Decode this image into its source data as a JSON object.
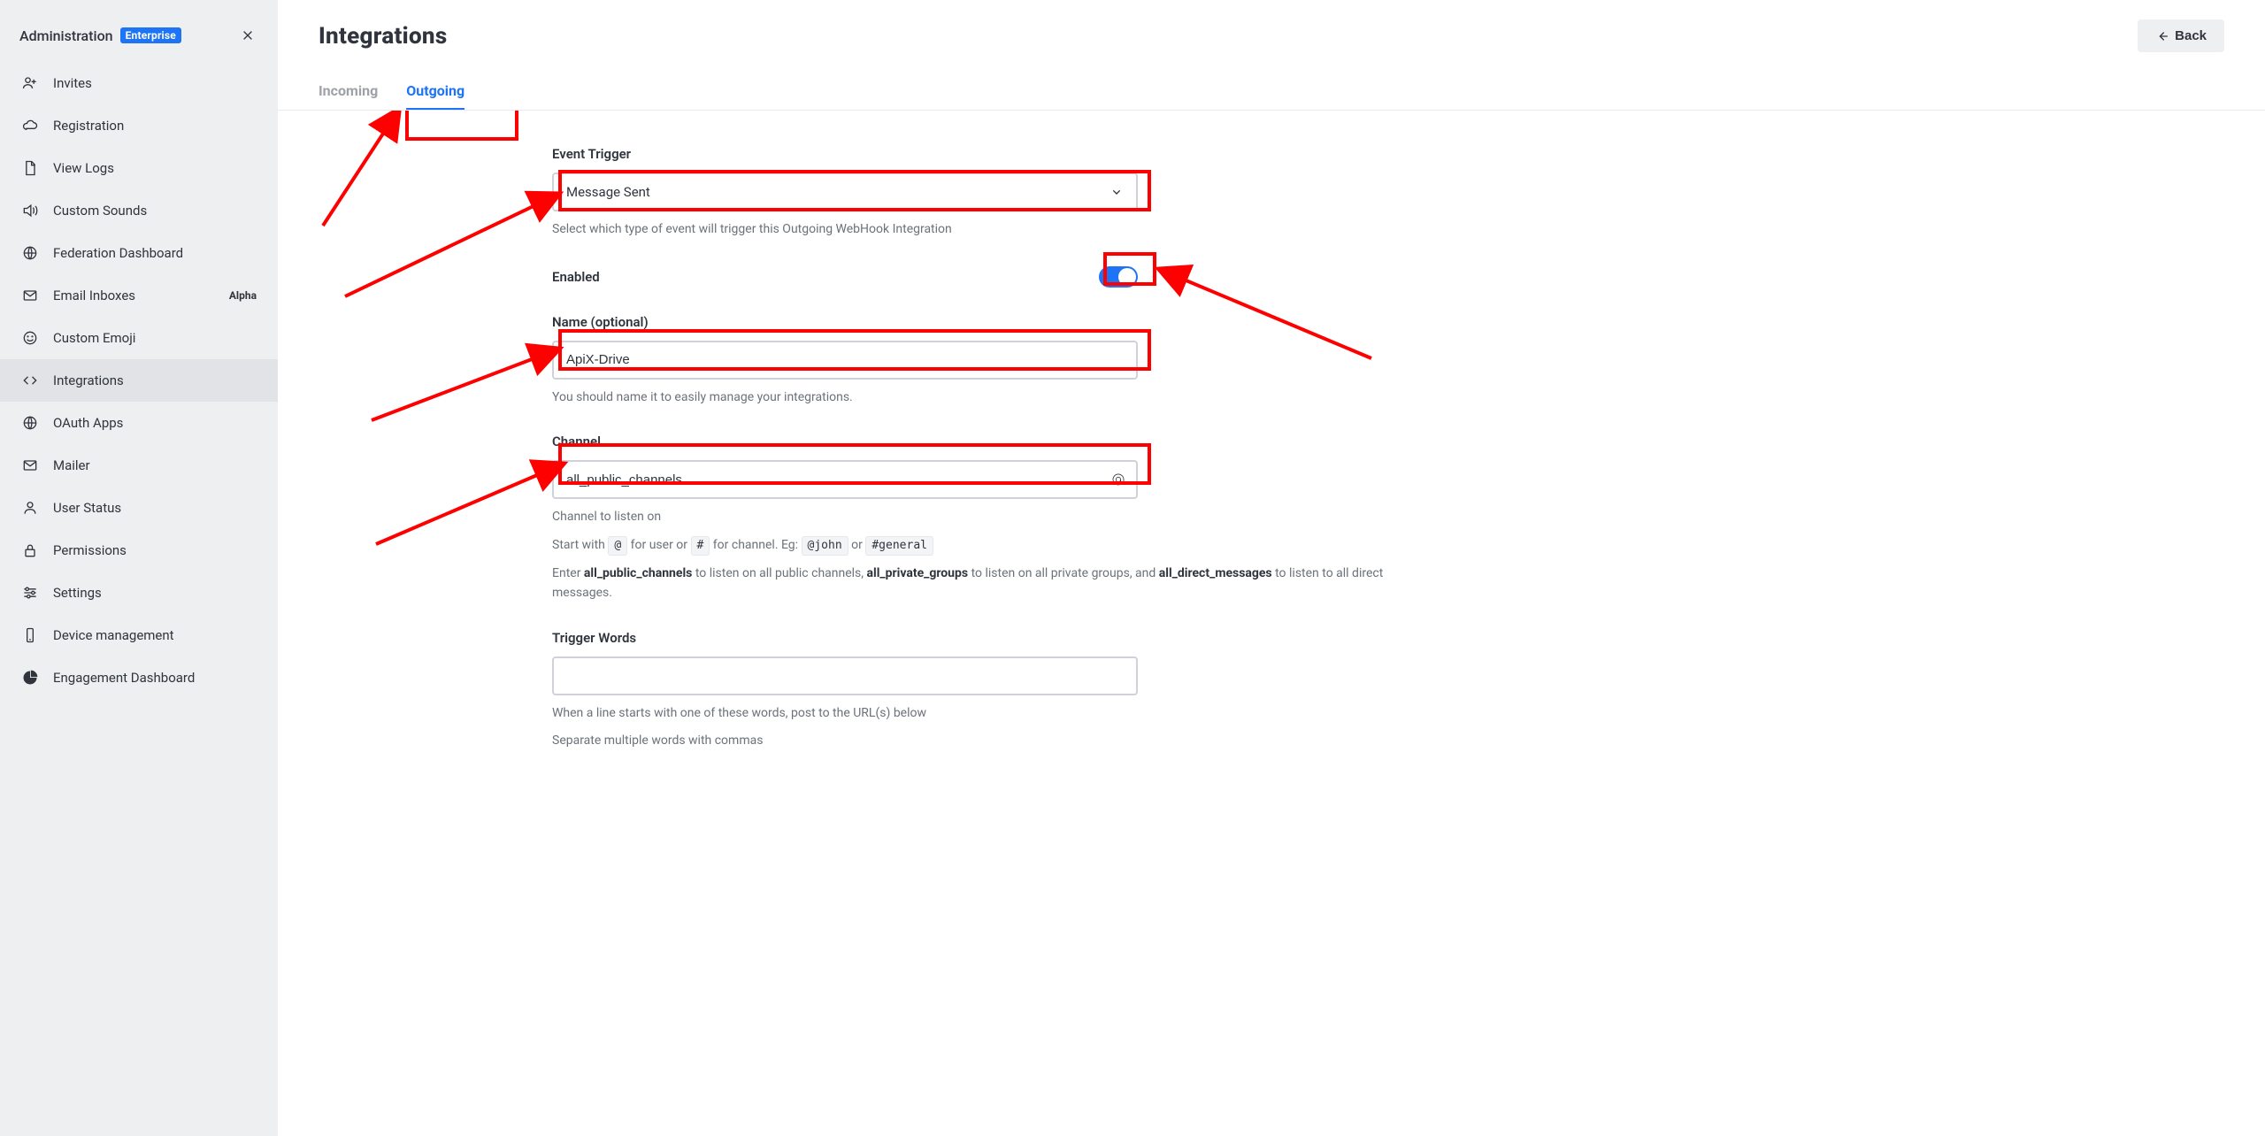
{
  "sidebar": {
    "title": "Administration",
    "badge": "Enterprise",
    "items": [
      {
        "label": "Invites",
        "icon": "user-plus"
      },
      {
        "label": "Registration",
        "icon": "cloud"
      },
      {
        "label": "View Logs",
        "icon": "file"
      },
      {
        "label": "Custom Sounds",
        "icon": "volume"
      },
      {
        "label": "Federation Dashboard",
        "icon": "globe"
      },
      {
        "label": "Email Inboxes",
        "icon": "mail",
        "badge": "Alpha"
      },
      {
        "label": "Custom Emoji",
        "icon": "smile"
      },
      {
        "label": "Integrations",
        "icon": "code",
        "active": true
      },
      {
        "label": "OAuth Apps",
        "icon": "globe"
      },
      {
        "label": "Mailer",
        "icon": "mail"
      },
      {
        "label": "User Status",
        "icon": "user"
      },
      {
        "label": "Permissions",
        "icon": "lock"
      },
      {
        "label": "Settings",
        "icon": "sliders"
      },
      {
        "label": "Device management",
        "icon": "phone"
      },
      {
        "label": "Engagement Dashboard",
        "icon": "pie"
      }
    ]
  },
  "header": {
    "title": "Integrations",
    "back_label": "Back"
  },
  "tabs": {
    "incoming": "Incoming",
    "outgoing": "Outgoing",
    "active": "outgoing"
  },
  "form": {
    "event_trigger": {
      "label": "Event Trigger",
      "value": "Message Sent",
      "help": "Select which type of event will trigger this Outgoing WebHook Integration"
    },
    "enabled": {
      "label": "Enabled",
      "value": true
    },
    "name": {
      "label": "Name (optional)",
      "value": "ApiX-Drive",
      "help": "You should name it to easily manage your integrations."
    },
    "channel": {
      "label": "Channel",
      "value": "all_public_channels",
      "help_line1": "Channel to listen on",
      "help_line2_prefix": "Start with ",
      "help_at": "@",
      "help_for_user": " for user or ",
      "help_hash": "#",
      "help_for_channel": " for channel. Eg: ",
      "help_eg1": "@john",
      "help_or": " or ",
      "help_eg2": "#general",
      "help_line3_a": "Enter ",
      "help_line3_b": "all_public_channels",
      "help_line3_c": " to listen on all public channels, ",
      "help_line3_d": "all_private_groups",
      "help_line3_e": " to listen on all private groups, and ",
      "help_line3_f": "all_direct_messages",
      "help_line3_g": " to listen to all direct messages."
    },
    "trigger_words": {
      "label": "Trigger Words",
      "value": "",
      "help1": "When a line starts with one of these words, post to the URL(s) below",
      "help2": "Separate multiple words with commas"
    }
  },
  "colors": {
    "accent": "#1d74f5",
    "highlight": "#ff0000"
  }
}
